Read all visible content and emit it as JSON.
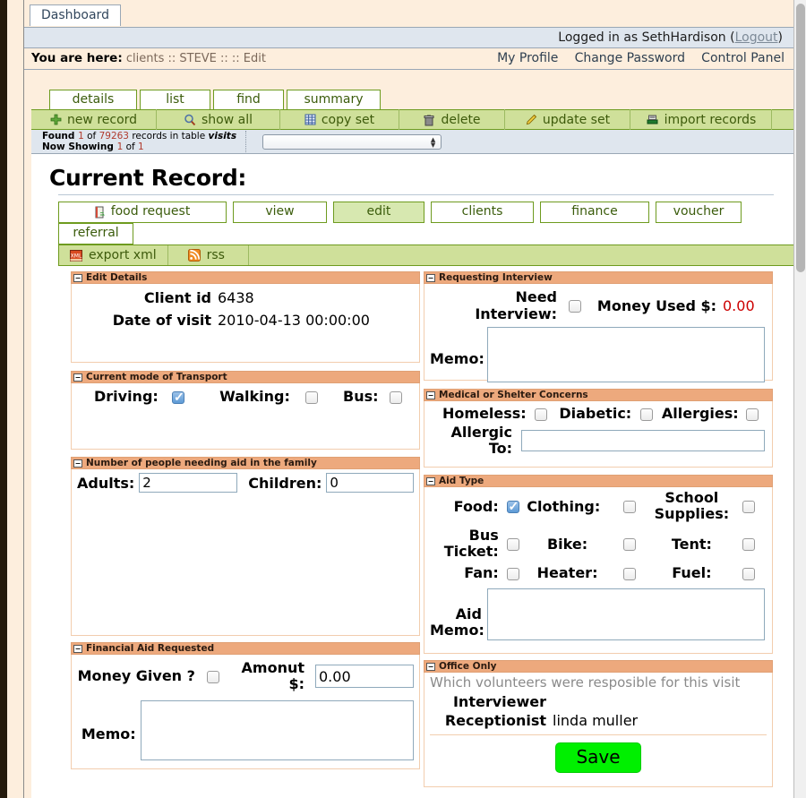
{
  "header": {
    "dashboard_tab": "Dashboard",
    "logged_in_prefix": "Logged in as ",
    "user": "SethHardison",
    "logout": "Logout",
    "you_are_here_label": "You are here:",
    "breadcrumb": "clients :: STEVE :: :: Edit",
    "links": [
      "My Profile",
      "Change Password",
      "Control Panel"
    ]
  },
  "nav": {
    "tabs": [
      {
        "label": "details",
        "active": true
      },
      {
        "label": "list",
        "active": false
      },
      {
        "label": "find",
        "active": false
      },
      {
        "label": "summary",
        "active": false
      }
    ],
    "toolbar": [
      {
        "label": "new record",
        "icon": "plus-icon"
      },
      {
        "label": "show all",
        "icon": "magnifier-icon"
      },
      {
        "label": "copy set",
        "icon": "grid-icon"
      },
      {
        "label": "delete",
        "icon": "trash-icon"
      },
      {
        "label": "update set",
        "icon": "pencil-icon"
      },
      {
        "label": "import records",
        "icon": "import-icon"
      }
    ]
  },
  "found": {
    "line1_prefix": "Found ",
    "line1_count": "1",
    "line1_mid": " of ",
    "line1_total": "79263",
    "line1_suffix": " records in table ",
    "line1_table": "visits",
    "line2_prefix": "Now Showing ",
    "line2_a": "1",
    "line2_mid": " of ",
    "line2_b": "1",
    "select_value": ""
  },
  "record": {
    "title": "Current Record:",
    "subtabs_row1": [
      {
        "label": "food request",
        "icon": "food-request-icon",
        "selected": false
      },
      {
        "label": "view",
        "icon": "",
        "selected": false
      },
      {
        "label": "edit",
        "icon": "",
        "selected": true
      },
      {
        "label": "clients",
        "icon": "",
        "selected": false
      },
      {
        "label": "finance",
        "icon": "",
        "selected": false
      },
      {
        "label": "voucher",
        "icon": "",
        "selected": false
      }
    ],
    "subtabs_row2": [
      {
        "label": "referral",
        "icon": "",
        "selected": false
      }
    ],
    "actionbar": [
      {
        "label": "export xml",
        "icon": "xml-icon"
      },
      {
        "label": "rss",
        "icon": "rss-icon"
      }
    ]
  },
  "edit_details": {
    "title": "Edit Details",
    "client_id_label": "Client id",
    "client_id_value": "6438",
    "date_label": "Date of visit",
    "date_value": "2010-04-13 00:00:00"
  },
  "requesting_interview": {
    "title": "Requesting Interview",
    "need_interview_label": "Need Interview:",
    "need_interview_checked": false,
    "money_used_label": "Money Used $:",
    "money_used_value": "0.00",
    "memo_label": "Memo:",
    "memo_value": ""
  },
  "transport": {
    "title": "Current mode of Transport",
    "items": [
      {
        "label": "Driving:",
        "checked": true
      },
      {
        "label": "Walking:",
        "checked": false
      },
      {
        "label": "Bus:",
        "checked": false
      }
    ]
  },
  "medical": {
    "title": "Medical or Shelter Concerns",
    "items": [
      {
        "label": "Homeless:",
        "checked": false
      },
      {
        "label": "Diabetic:",
        "checked": false
      },
      {
        "label": "Allergies:",
        "checked": false
      }
    ],
    "allergic_to_label": "Allergic To:",
    "allergic_to_value": ""
  },
  "family": {
    "title": "Number of people needing aid in the family",
    "adults_label": "Adults:",
    "adults_value": "2",
    "children_label": "Children:",
    "children_value": "0"
  },
  "aid_type": {
    "title": "Aid Type",
    "row1": [
      {
        "label": "Food:",
        "checked": true
      },
      {
        "label": "Clothing:",
        "checked": false
      },
      {
        "label": "School Supplies:",
        "checked": false
      }
    ],
    "row2": [
      {
        "label": "Bus Ticket:",
        "checked": false
      },
      {
        "label": "Bike:",
        "checked": false
      },
      {
        "label": "Tent:",
        "checked": false
      }
    ],
    "row3": [
      {
        "label": "Fan:",
        "checked": false
      },
      {
        "label": "Heater:",
        "checked": false
      },
      {
        "label": "Fuel:",
        "checked": false
      }
    ],
    "aid_memo_label": "Aid Memo:",
    "aid_memo_value": ""
  },
  "financial": {
    "title": "Financial Aid Requested",
    "money_given_label": "Money Given ?",
    "money_given_checked": false,
    "amount_label": "Amonut $:",
    "amount_value": "0.00",
    "memo_label": "Memo:",
    "memo_value": ""
  },
  "office": {
    "title": "Office Only",
    "note": "Which volunteers were resposible for this visit",
    "interviewer_label": "Interviewer",
    "interviewer_value": "",
    "receptionist_label": "Receptionist",
    "receptionist_value": "linda muller",
    "save_label": "Save"
  },
  "colors": {
    "panel_header": "#eda97d",
    "green_bar": "#cfe09a",
    "green_border": "#6e9b1f",
    "save_green": "#00f000",
    "page_bg": "#fdeedd",
    "login_bar": "#dfe6ee",
    "money_red": "#cc0000"
  }
}
